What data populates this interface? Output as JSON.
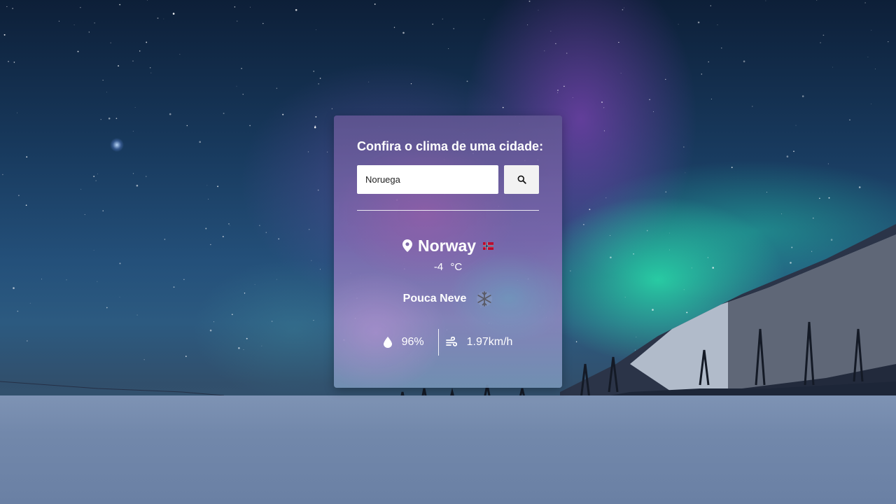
{
  "colors": {
    "card_text": "#ffffff",
    "button_bg": "#f2f2f2",
    "sky_top": "#0d1f38",
    "aurora_green": "#28f0af",
    "aurora_purple": "#a046d2",
    "snow": "#7e93b4"
  },
  "background": {
    "scene": "night-sky-aurora-snow-icon"
  },
  "weather_card": {
    "title": "Confira o clima de uma cidade:",
    "search": {
      "value": "Noruega",
      "placeholder": "",
      "button_icon": "search-icon"
    },
    "location": {
      "pin_icon": "location-pin-icon",
      "city": "Norway",
      "flag_icon": "norway-flag-icon"
    },
    "temperature": {
      "value": "-4",
      "unit": "°C"
    },
    "condition": {
      "description": "Pouca Neve",
      "icon": "snowflake-icon"
    },
    "humidity": {
      "icon": "water-drop-icon",
      "value": "96%"
    },
    "wind": {
      "icon": "wind-icon",
      "value": "1.97km/h"
    }
  }
}
